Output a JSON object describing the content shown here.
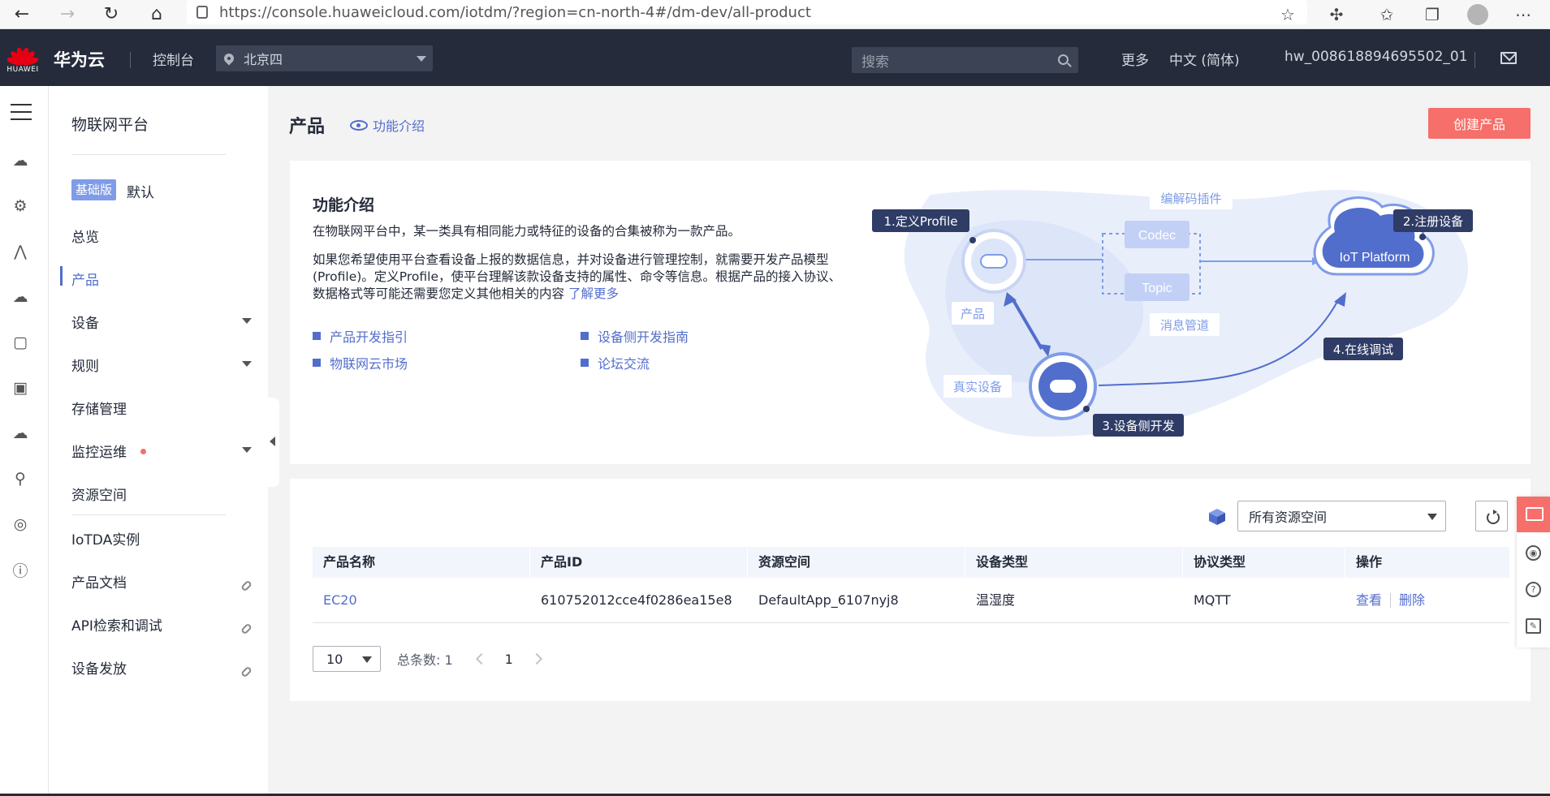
{
  "browser": {
    "url": "https://console.huaweicloud.com/iotdm/?region=cn-north-4#/dm-dev/all-product"
  },
  "header": {
    "logo_text": "HUAWEI",
    "brand": "华为云",
    "console": "控制台",
    "region": "北京四",
    "search_placeholder": "搜索",
    "more": "更多",
    "language": "中文 (简体)",
    "username": "hw_008618894695502_01"
  },
  "sidenav": {
    "title": "物联网平台",
    "edition_badge": "基础版",
    "edition_default": "默认",
    "items": [
      {
        "label": "总览"
      },
      {
        "label": "产品"
      },
      {
        "label": "设备"
      },
      {
        "label": "规则"
      },
      {
        "label": "存储管理"
      },
      {
        "label": "监控运维"
      },
      {
        "label": "资源空间"
      },
      {
        "label": "IoTDA实例"
      },
      {
        "label": "产品文档"
      },
      {
        "label": "API检索和调试"
      },
      {
        "label": "设备发放"
      }
    ]
  },
  "main": {
    "page_title": "产品",
    "feature_link": "功能介绍",
    "create_button": "创建产品",
    "intro": {
      "heading": "功能介绍",
      "para1": "在物联网平台中，某一类具有相同能力或特征的设备的合集被称为一款产品。",
      "para2": "如果您希望使用平台查看设备上报的数据信息，并对设备进行管理控制，就需要开发产品模型(Profile)。定义Profile，使平台理解该款设备支持的属性、命令等信息。根据产品的接入协议、数据格式等可能还需要您定义其他相关的内容",
      "learn_more": "了解更多",
      "links": [
        "产品开发指引",
        "设备侧开发指南",
        "物联网云市场",
        "论坛交流"
      ]
    },
    "diagram": {
      "step1": "1.定义Profile",
      "step2": "2.注册设备",
      "step3": "3.设备侧开发",
      "step4": "4.在线调试",
      "codec_plugin": "编解码插件",
      "codec": "Codec",
      "topic": "Topic",
      "message_pipe": "消息管道",
      "product": "产品",
      "real_device": "真实设备",
      "platform": "IoT Platform"
    },
    "table": {
      "resource_space_select": "所有资源空间",
      "columns": [
        "产品名称",
        "产品ID",
        "资源空间",
        "设备类型",
        "协议类型",
        "操作"
      ],
      "rows": [
        {
          "name": "EC20",
          "id": "610752012cce4f0286ea15e8",
          "space": "DefaultApp_6107nyj8",
          "device_type": "温湿度",
          "protocol": "MQTT",
          "view": "查看",
          "delete": "删除"
        }
      ]
    },
    "pager": {
      "page_size": "10",
      "total": "总条数: 1",
      "current_page": "1"
    }
  },
  "colors": {
    "accent": "#526ecc",
    "brand_red": "#f66f6a",
    "header_bg": "#252b3a"
  }
}
